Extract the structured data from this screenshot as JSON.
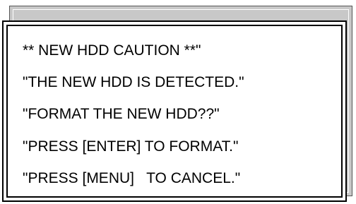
{
  "dialog": {
    "lines": [
      "** NEW HDD CAUTION **\"",
      "\"THE NEW HDD IS DETECTED.\"",
      "\"FORMAT THE NEW HDD??\"",
      "\"PRESS [ENTER] TO FORMAT.\"",
      "\"PRESS [MENU]   TO CANCEL.\""
    ]
  },
  "colors": {
    "background": "#ffffff",
    "back_panel": "#c8c8c8",
    "border": "#000000",
    "text": "#000000"
  }
}
